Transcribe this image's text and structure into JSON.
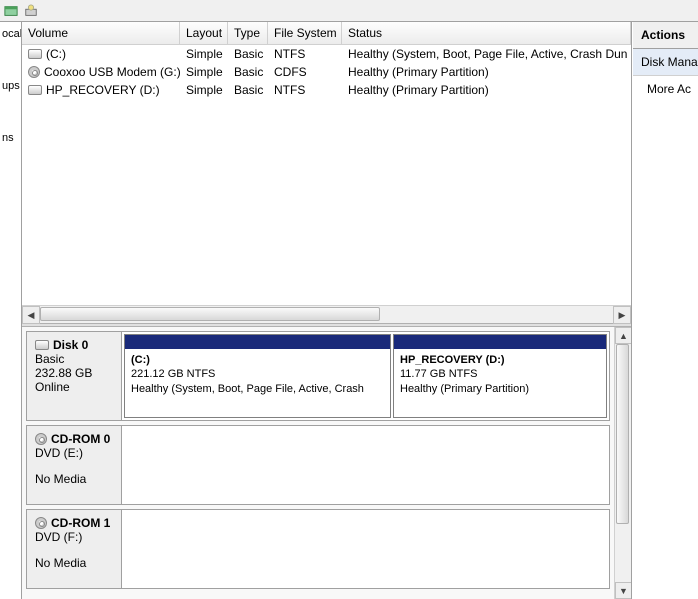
{
  "left_nav": {
    "item0": "ocal",
    "item1": "ups",
    "item2": "ns"
  },
  "columns": {
    "volume": "Volume",
    "layout": "Layout",
    "type": "Type",
    "fs": "File System",
    "status": "Status"
  },
  "volumes": [
    {
      "icon": "drive",
      "name": "(C:)",
      "layout": "Simple",
      "type": "Basic",
      "fs": "NTFS",
      "status": "Healthy (System, Boot, Page File, Active, Crash Dun"
    },
    {
      "icon": "cd",
      "name": "Cooxoo USB Modem (G:)",
      "layout": "Simple",
      "type": "Basic",
      "fs": "CDFS",
      "status": "Healthy (Primary Partition)"
    },
    {
      "icon": "drive",
      "name": "HP_RECOVERY (D:)",
      "layout": "Simple",
      "type": "Basic",
      "fs": "NTFS",
      "status": "Healthy (Primary Partition)"
    }
  ],
  "disks": [
    {
      "title": "Disk 0",
      "type": "Basic",
      "size": "232.88 GB",
      "state": "Online",
      "icon": "drive",
      "partitions": [
        {
          "name": "(C:)",
          "size": "221.12 GB NTFS",
          "status": "Healthy (System, Boot, Page File, Active, Crash",
          "flex": "5"
        },
        {
          "name": "HP_RECOVERY  (D:)",
          "size": "11.77 GB NTFS",
          "status": "Healthy (Primary Partition)",
          "flex": "4"
        }
      ]
    },
    {
      "title": "CD-ROM 0",
      "type": "DVD (E:)",
      "size": "",
      "state": "No Media",
      "icon": "cd",
      "partitions": []
    },
    {
      "title": "CD-ROM 1",
      "type": "DVD (F:)",
      "size": "",
      "state": "No Media",
      "icon": "cd",
      "partitions": []
    }
  ],
  "actions": {
    "header": "Actions",
    "main": "Disk Manage",
    "sub": "More Ac"
  }
}
